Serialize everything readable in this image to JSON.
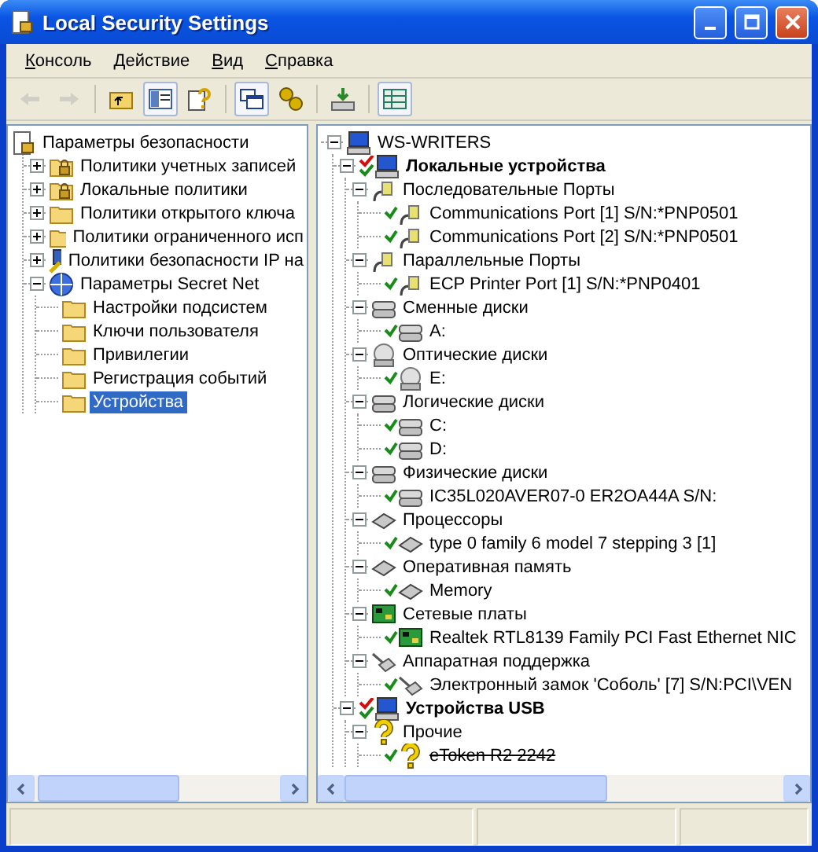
{
  "window": {
    "title": "Local Security Settings"
  },
  "menu": [
    "Консоль",
    "Действие",
    "Вид",
    "Справка"
  ],
  "toolbar": [
    {
      "kind": "back",
      "disabled": true,
      "pressed": false
    },
    {
      "kind": "forward",
      "disabled": true,
      "pressed": false
    },
    {
      "kind": "up",
      "disabled": false,
      "pressed": false
    },
    {
      "kind": "tree",
      "disabled": false,
      "pressed": true
    },
    {
      "kind": "help",
      "disabled": false,
      "pressed": false
    },
    {
      "kind": "window",
      "disabled": false,
      "pressed": true
    },
    {
      "kind": "gears",
      "disabled": false,
      "pressed": false
    },
    {
      "kind": "export",
      "disabled": false,
      "pressed": false
    },
    {
      "kind": "grid",
      "disabled": false,
      "pressed": true
    }
  ],
  "left_tree": [
    {
      "label": "Параметры безопасности",
      "kind": "security",
      "selected": false,
      "children": [
        {
          "label": "Политики учетных записей",
          "kind": "lockfolder",
          "expanded": false,
          "selected": false
        },
        {
          "label": "Локальные политики",
          "kind": "lockfolder",
          "expanded": false,
          "selected": false
        },
        {
          "label": "Политики открытого ключа",
          "kind": "folder",
          "expanded": false,
          "selected": false
        },
        {
          "label": "Политики ограниченного исп",
          "kind": "folder",
          "expanded": false,
          "selected": false
        },
        {
          "label": "Политики безопасности IP на",
          "kind": "ip",
          "expanded": false,
          "selected": false
        },
        {
          "label": "Параметры Secret Net",
          "kind": "secretnet",
          "expanded": true,
          "selected": false,
          "children": [
            {
              "label": "Настройки подсистем",
              "kind": "folder",
              "selected": false
            },
            {
              "label": "Ключи пользователя",
              "kind": "folder",
              "selected": false
            },
            {
              "label": "Привилегии",
              "kind": "folder",
              "selected": false
            },
            {
              "label": "Регистрация событий",
              "kind": "folder",
              "selected": false
            },
            {
              "label": "Устройства",
              "kind": "folder",
              "selected": true
            }
          ]
        }
      ]
    }
  ],
  "right_tree": [
    {
      "label": "WS-WRITERS",
      "kind": "computer",
      "checked": false,
      "expanded": true,
      "children": [
        {
          "label": "Локальные устройства",
          "kind": "computer",
          "checked": true,
          "mixed": true,
          "bold": true,
          "expanded": true,
          "children": [
            {
              "label": "Последовательные Порты",
              "kind": "port",
              "checked": false,
              "expanded": true,
              "children": [
                {
                  "label": "Communications Port [1] S/N:*PNP0501",
                  "kind": "port",
                  "checked": true
                },
                {
                  "label": "Communications Port [2] S/N:*PNP0501",
                  "kind": "port",
                  "checked": true
                }
              ]
            },
            {
              "label": "Параллельные Порты",
              "kind": "port",
              "checked": false,
              "expanded": true,
              "children": [
                {
                  "label": "ECP Printer Port [1] S/N:*PNP0401",
                  "kind": "port",
                  "checked": true
                }
              ]
            },
            {
              "label": "Сменные диски",
              "kind": "drive",
              "checked": false,
              "expanded": true,
              "children": [
                {
                  "label": "A:",
                  "kind": "drive",
                  "checked": true
                }
              ]
            },
            {
              "label": "Оптические диски",
              "kind": "cd",
              "checked": false,
              "expanded": true,
              "children": [
                {
                  "label": "E:",
                  "kind": "cd",
                  "checked": true
                }
              ]
            },
            {
              "label": "Логические диски",
              "kind": "drive",
              "checked": false,
              "expanded": true,
              "children": [
                {
                  "label": "C:",
                  "kind": "drive",
                  "checked": true
                },
                {
                  "label": "D:",
                  "kind": "drive",
                  "checked": true
                }
              ]
            },
            {
              "label": "Физические диски",
              "kind": "drive",
              "checked": false,
              "expanded": true,
              "children": [
                {
                  "label": "IC35L020AVER07-0 ER2OA44A S/N:",
                  "kind": "drive",
                  "checked": true
                }
              ]
            },
            {
              "label": "Процессоры",
              "kind": "chip",
              "checked": false,
              "expanded": true,
              "children": [
                {
                  "label": "type 0 family 6 model 7 stepping 3 [1]",
                  "kind": "chip",
                  "checked": true
                }
              ]
            },
            {
              "label": "Оперативная память",
              "kind": "chip",
              "checked": false,
              "expanded": true,
              "children": [
                {
                  "label": "Memory",
                  "kind": "chip",
                  "checked": true
                }
              ]
            },
            {
              "label": "Сетевые платы",
              "kind": "nic",
              "checked": false,
              "expanded": true,
              "children": [
                {
                  "label": "Realtek RTL8139 Family PCI Fast Ethernet NIC",
                  "kind": "nic",
                  "checked": true
                }
              ]
            },
            {
              "label": "Аппаратная поддержка",
              "kind": "hardware",
              "checked": false,
              "expanded": true,
              "children": [
                {
                  "label": "Электронный замок 'Соболь' [7] S/N:PCI\\VEN",
                  "kind": "hardware",
                  "checked": true
                }
              ]
            }
          ]
        },
        {
          "label": "Устройства USB",
          "kind": "computer",
          "checked": true,
          "mixed": true,
          "bold": true,
          "expanded": true,
          "children": [
            {
              "label": "Прочие",
              "kind": "question",
              "checked": false,
              "expanded": true,
              "children": [
                {
                  "label": "eToken R2 2242",
                  "kind": "question",
                  "checked": true,
                  "struck": true
                }
              ]
            }
          ]
        }
      ]
    }
  ]
}
